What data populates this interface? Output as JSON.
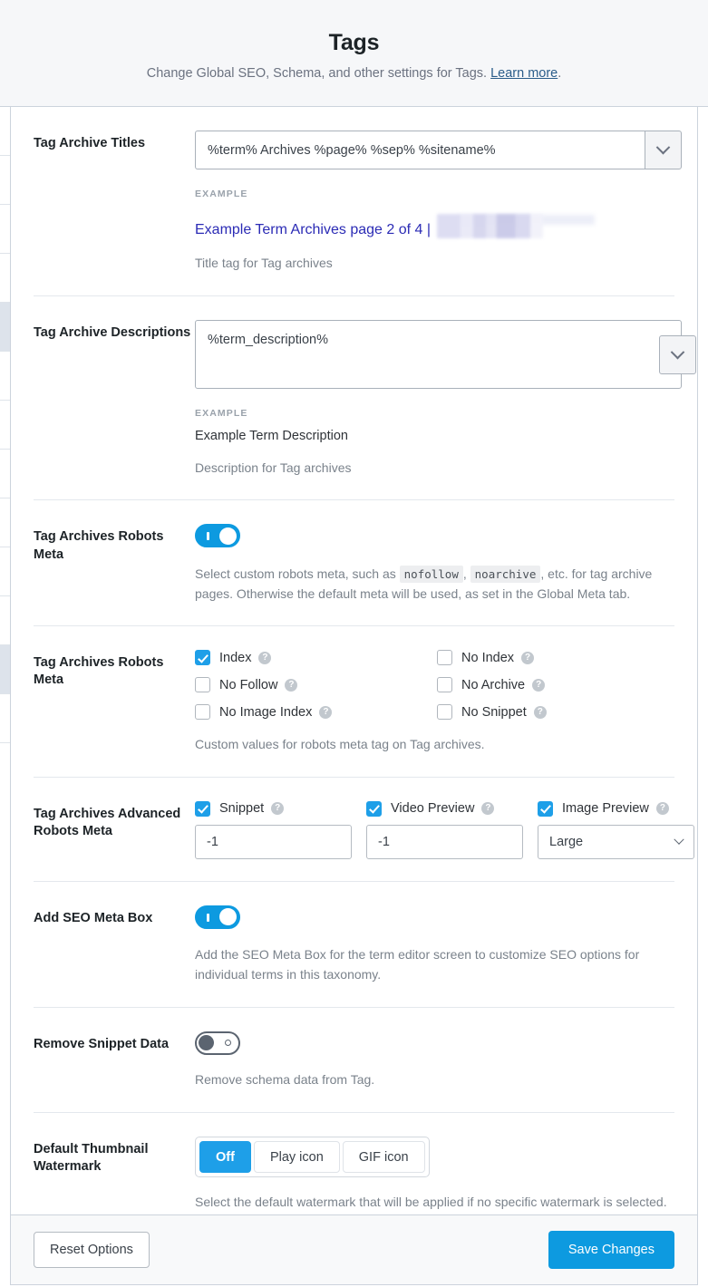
{
  "header": {
    "title": "Tags",
    "subtitle_before": "Change Global SEO, Schema, and other settings for Tags. ",
    "link_label": "Learn more",
    "subtitle_after": "."
  },
  "rows": {
    "tag_archive_titles": {
      "label": "Tag Archive Titles",
      "value": "%term% Archives %page% %sep% %sitename%",
      "example_label": "EXAMPLE",
      "example_value": "Example Term Archives page 2 of 4 |",
      "help": "Title tag for Tag archives",
      "dropdown_icon": "chevron-down-icon"
    },
    "tag_archive_descriptions": {
      "label": "Tag Archive Descriptions",
      "value": "%term_description%",
      "example_label": "EXAMPLE",
      "example_value": "Example Term Description",
      "help": "Description for Tag archives",
      "dropdown_icon": "chevron-down-icon"
    },
    "robots_meta_toggle": {
      "label": "Tag Archives Robots Meta",
      "toggle_state": "on",
      "help_part1": "Select custom robots meta, such as ",
      "code1": "nofollow",
      "help_part2": ", ",
      "code2": "noarchive",
      "help_part3": ", etc. for tag archive pages. Otherwise the default meta will be used, as set in the Global Meta tab."
    },
    "robots_meta_checkboxes": {
      "label": "Tag Archives Robots Meta",
      "items": [
        {
          "label": "Index",
          "checked": true
        },
        {
          "label": "No Index",
          "checked": false
        },
        {
          "label": "No Follow",
          "checked": false
        },
        {
          "label": "No Archive",
          "checked": false
        },
        {
          "label": "No Image Index",
          "checked": false
        },
        {
          "label": "No Snippet",
          "checked": false
        }
      ],
      "help": "Custom values for robots meta tag on Tag archives."
    },
    "advanced_robots_meta": {
      "label": "Tag Archives Advanced Robots Meta",
      "columns": [
        {
          "label": "Snippet",
          "checked": true,
          "type": "input",
          "value": "-1"
        },
        {
          "label": "Video Preview",
          "checked": true,
          "type": "input",
          "value": "-1"
        },
        {
          "label": "Image Preview",
          "checked": true,
          "type": "select",
          "value": "Large"
        }
      ]
    },
    "add_seo_meta_box": {
      "label": "Add SEO Meta Box",
      "toggle_state": "on",
      "help": "Add the SEO Meta Box for the term editor screen to customize SEO options for individual terms in this taxonomy."
    },
    "remove_snippet_data": {
      "label": "Remove Snippet Data",
      "toggle_state": "off",
      "help": "Remove schema data from Tag."
    },
    "default_thumbnail_watermark": {
      "label": "Default Thumbnail Watermark",
      "options": [
        {
          "label": "Off",
          "active": true
        },
        {
          "label": "Play icon",
          "active": false
        },
        {
          "label": "GIF icon",
          "active": false
        }
      ],
      "help": "Select the default watermark that will be applied if no specific watermark is selected."
    }
  },
  "footer": {
    "reset_label": "Reset Options",
    "save_label": "Save Changes"
  },
  "colors": {
    "accent": "#0d9ae0",
    "checkbox_checked": "#1e9fe8",
    "link": "#2b5d8a",
    "example_text": "#2b2bb5"
  },
  "help_icon": "?"
}
